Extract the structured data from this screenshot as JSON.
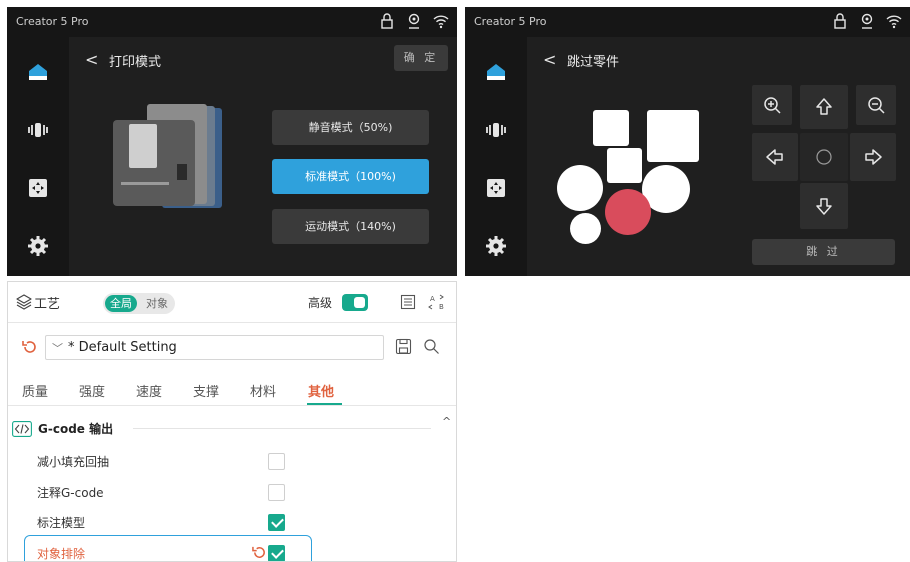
{
  "left_screen": {
    "brand": "Creator 5 Pro",
    "title": "打印模式",
    "back": "<",
    "confirm_label": "确 定",
    "modes": [
      {
        "label": "静音模式（50%)",
        "active": false
      },
      {
        "label": "标准模式（100%)",
        "active": true
      },
      {
        "label": "运动模式（140%)",
        "active": false
      }
    ],
    "sidebar_icons": [
      "home-icon",
      "vibration-icon",
      "move-icon",
      "settings-icon"
    ],
    "status_icons": [
      "lock-icon",
      "camera-icon",
      "wifi-icon"
    ]
  },
  "right_screen": {
    "brand": "Creator 5 Pro",
    "title": "跳过零件",
    "back": "<",
    "skip_label": "跳 过",
    "control_icons": [
      "zoom-in-icon",
      "arrow-up-icon",
      "zoom-out-icon",
      "arrow-left-icon",
      "center-icon",
      "arrow-right-icon",
      "arrow-down-icon"
    ],
    "selected_part_color": "#d94c5c"
  },
  "slicer": {
    "title": "工艺",
    "scope": {
      "global": "全局",
      "object": "对象"
    },
    "advanced_label": "高级",
    "advanced_enabled": true,
    "preset": "* Default Setting",
    "tabs": [
      "质量",
      "强度",
      "速度",
      "支撑",
      "材料",
      "其他"
    ],
    "active_tab": "其他",
    "section": "G-code 输出",
    "options": [
      {
        "label": "减小填充回抽",
        "checked": false
      },
      {
        "label": "注释G-code",
        "checked": false
      },
      {
        "label": "标注模型",
        "checked": true
      },
      {
        "label": "对象排除",
        "checked": true,
        "highlighted": true
      }
    ],
    "accent_color": "#17a98d",
    "highlight_color": "#e0623f"
  }
}
